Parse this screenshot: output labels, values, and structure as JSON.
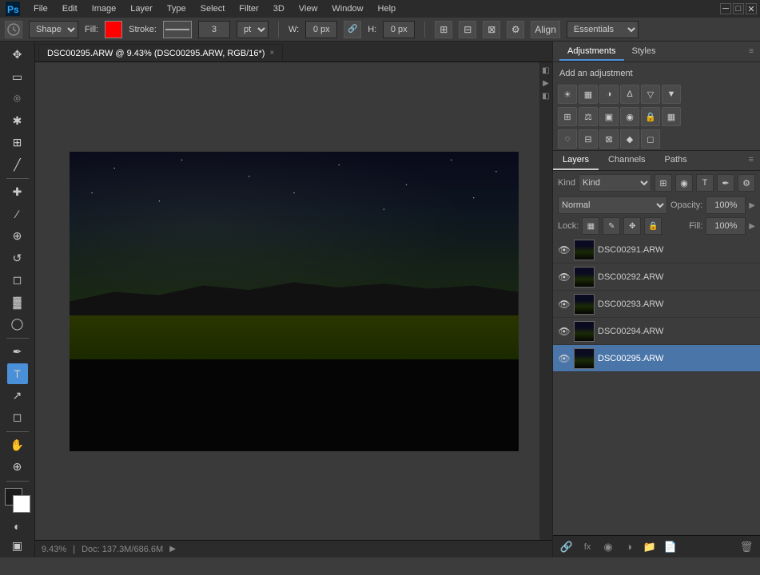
{
  "app": {
    "title": "Adobe Photoshop",
    "logo": "Ps"
  },
  "menubar": {
    "items": [
      "File",
      "Edit",
      "Image",
      "Layer",
      "Type",
      "Select",
      "Filter",
      "3D",
      "View",
      "Window",
      "Help"
    ]
  },
  "optionsbar": {
    "tool_select_label": "Shape",
    "fill_label": "Fill:",
    "fill_color": "#ff0000",
    "stroke_label": "Stroke:",
    "stroke_width": "3",
    "stroke_unit": "pt",
    "w_label": "W:",
    "w_value": "0 px",
    "h_label": "H:",
    "h_value": "0 px",
    "align_label": "Align",
    "workspace_label": "Essentials"
  },
  "tab": {
    "title": "DSC00295.ARW @ 9.43% (DSC00295.ARW, RGB/16*)",
    "close_icon": "×"
  },
  "toolbar": {
    "tools": [
      {
        "name": "move",
        "icon": "✥"
      },
      {
        "name": "select-rect",
        "icon": "▭"
      },
      {
        "name": "lasso",
        "icon": "⌾"
      },
      {
        "name": "quick-select",
        "icon": "⚡"
      },
      {
        "name": "crop",
        "icon": "⊞"
      },
      {
        "name": "eyedropper",
        "icon": "💉"
      },
      {
        "name": "healing",
        "icon": "✚"
      },
      {
        "name": "brush",
        "icon": "🖌"
      },
      {
        "name": "clone",
        "icon": "✎"
      },
      {
        "name": "history-brush",
        "icon": "↺"
      },
      {
        "name": "eraser",
        "icon": "◻"
      },
      {
        "name": "gradient",
        "icon": "▓"
      },
      {
        "name": "dodge",
        "icon": "◯"
      },
      {
        "name": "pen",
        "icon": "✒"
      },
      {
        "name": "text",
        "icon": "T"
      },
      {
        "name": "path-select",
        "icon": "↗"
      },
      {
        "name": "shape",
        "icon": "◻"
      },
      {
        "name": "hand",
        "icon": "✋"
      },
      {
        "name": "zoom",
        "icon": "🔍"
      },
      {
        "name": "rotate-view",
        "icon": "↻"
      }
    ]
  },
  "status_bar": {
    "zoom": "9.43%",
    "doc_info": "Doc: 137.3M/686.6M"
  },
  "adjustments_panel": {
    "tabs": [
      "Adjustments",
      "Styles"
    ],
    "add_label": "Add an adjustment",
    "icons_row1": [
      "☀",
      "▦",
      "◑",
      "Δ",
      "▽",
      "▼"
    ],
    "icons_row2": [
      "⊞",
      "⚖",
      "▣",
      "◉",
      "🔒",
      "▦"
    ],
    "icons_row3": [
      "◌",
      "⊟",
      "⊠",
      "◆",
      "◻"
    ]
  },
  "layers_panel": {
    "tabs": [
      "Layers",
      "Channels",
      "Paths"
    ],
    "kind_label": "Kind",
    "blend_mode": "Normal",
    "opacity_label": "Opacity:",
    "opacity_value": "100%",
    "lock_label": "Lock:",
    "fill_label": "Fill:",
    "fill_value": "100%",
    "layers": [
      {
        "name": "DSC00291.ARW",
        "visible": true,
        "selected": false
      },
      {
        "name": "DSC00292.ARW",
        "visible": true,
        "selected": false
      },
      {
        "name": "DSC00293.ARW",
        "visible": true,
        "selected": false
      },
      {
        "name": "DSC00294.ARW",
        "visible": true,
        "selected": false
      },
      {
        "name": "DSC00295.ARW",
        "visible": true,
        "selected": true
      }
    ],
    "bottom_icons": [
      "🔗",
      "fx",
      "◉",
      "📄",
      "📁",
      "🗑"
    ]
  }
}
